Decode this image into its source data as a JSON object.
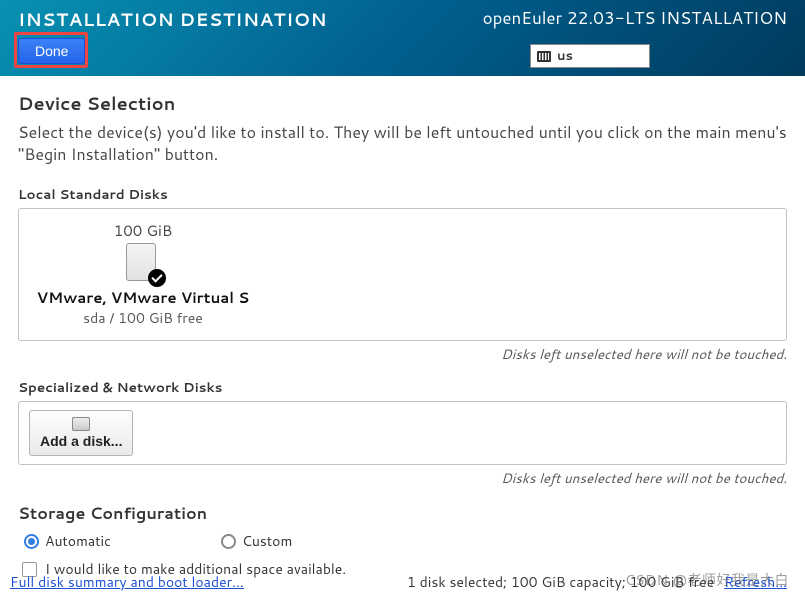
{
  "header": {
    "title": "INSTALLATION DESTINATION",
    "right_title": "openEuler 22.03-LTS INSTALLATION",
    "done_label": "Done",
    "lang_code": "us",
    "kb_icon": "keyboard-icon"
  },
  "device_selection": {
    "heading": "Device Selection",
    "intro": "Select the device(s) you'd like to install to.  They will be left untouched until you click on the main menu's \"Begin Installation\" button."
  },
  "local_disks": {
    "heading": "Local Standard Disks",
    "hint": "Disks left unselected here will not be touched.",
    "items": [
      {
        "size": "100 GiB",
        "name": "VMware, VMware Virtual S",
        "sub": "sda    /    100 GiB free",
        "selected": true
      }
    ]
  },
  "network_disks": {
    "heading": "Specialized & Network Disks",
    "add_label": "Add a disk...",
    "hint": "Disks left unselected here will not be touched."
  },
  "storage_config": {
    "heading": "Storage Configuration",
    "options": [
      {
        "label": "Automatic",
        "selected": true
      },
      {
        "label": "Custom",
        "selected": false
      }
    ],
    "free_space_label": "I would like to make additional space available.",
    "free_space_checked": false
  },
  "footer": {
    "summary_link": "Full disk summary and boot loader...",
    "status": "1 disk selected; 100 GiB capacity; 100 GiB free",
    "refresh_link": "Refresh..."
  },
  "watermark": "CSDN @老师好我是大白"
}
